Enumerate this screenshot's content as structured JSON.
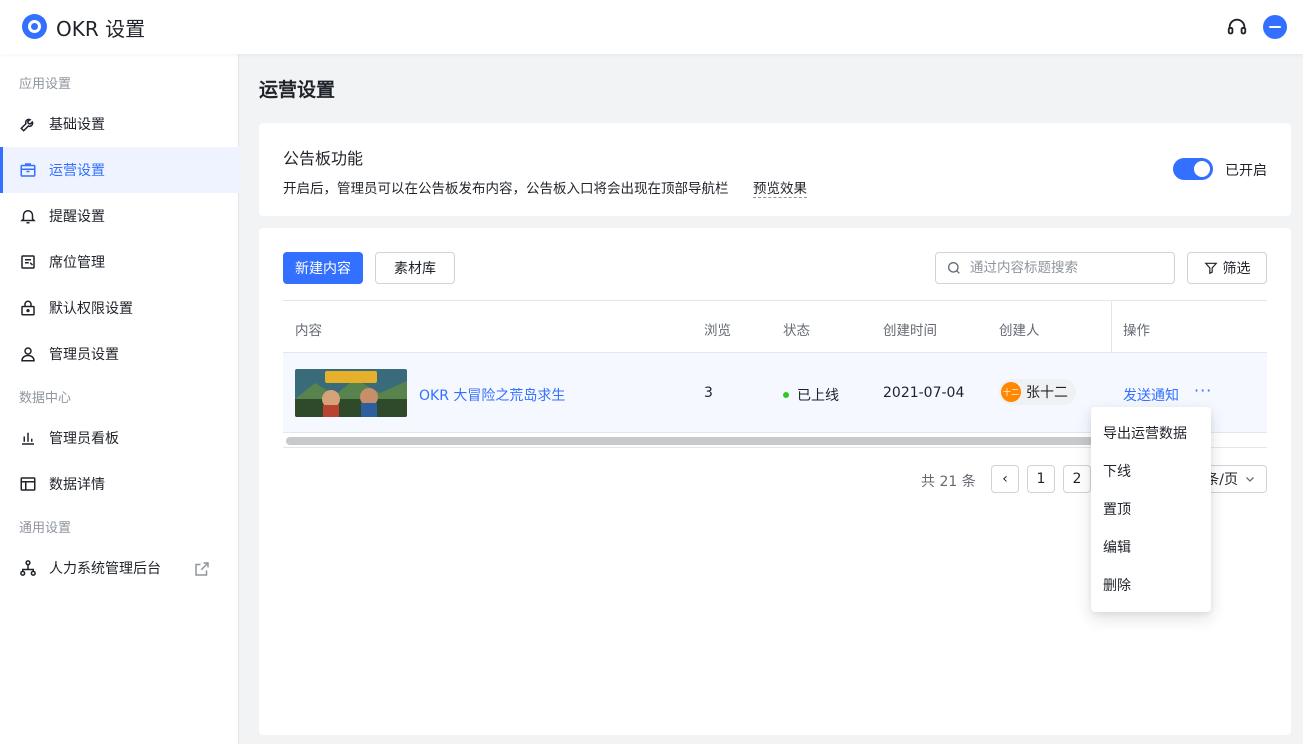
{
  "app": {
    "title": "OKR 设置"
  },
  "sidebar": {
    "groups": [
      {
        "label": "应用设置"
      },
      {
        "label": "数据中心"
      },
      {
        "label": "通用设置"
      }
    ],
    "items": [
      {
        "label": "基础设置",
        "icon": "wrench-icon"
      },
      {
        "label": "运营设置",
        "icon": "briefcase-icon",
        "active": true
      },
      {
        "label": "提醒设置",
        "icon": "bell-icon"
      },
      {
        "label": "席位管理",
        "icon": "seat-list-icon"
      },
      {
        "label": "默认权限设置",
        "icon": "lock-icon"
      },
      {
        "label": "管理员设置",
        "icon": "user-icon"
      },
      {
        "label": "管理员看板",
        "icon": "bar-chart-icon"
      },
      {
        "label": "数据详情",
        "icon": "table-icon"
      },
      {
        "label": "人力系统管理后台",
        "icon": "org-chart-icon"
      }
    ]
  },
  "main": {
    "title": "运营设置",
    "bulletin": {
      "title": "公告板功能",
      "description": "开启后，管理员可以在公告板发布内容，公告板入口将会出现在顶部导航栏",
      "preview_link": "预览效果",
      "toggle_state": "on",
      "toggle_label": "已开启"
    },
    "toolbar": {
      "new_button": "新建内容",
      "library_button": "素材库",
      "search_placeholder": "通过内容标题搜索",
      "filter_button": "筛选"
    },
    "table": {
      "columns": [
        "内容",
        "浏览",
        "状态",
        "创建时间",
        "创建人",
        "操作"
      ],
      "rows": [
        {
          "title": "OKR 大冒险之荒岛求生",
          "thumbnail_text": "荒岛求生",
          "views": "3",
          "status": "已上线",
          "created": "2021-07-04",
          "creator": "张十二",
          "creator_avatar": "十二",
          "op_link": "发送通知",
          "op_more": "···"
        }
      ]
    },
    "pagination": {
      "total": "共 21 条",
      "prev": "‹",
      "pages": [
        "1",
        "2"
      ],
      "page_size_suffix": "条/页"
    },
    "dropdown": {
      "items": [
        "导出运营数据",
        "下线",
        "置顶",
        "编辑",
        "删除"
      ]
    },
    "colors": {
      "accent": "#3370ff",
      "status_online": "#34c724"
    }
  }
}
